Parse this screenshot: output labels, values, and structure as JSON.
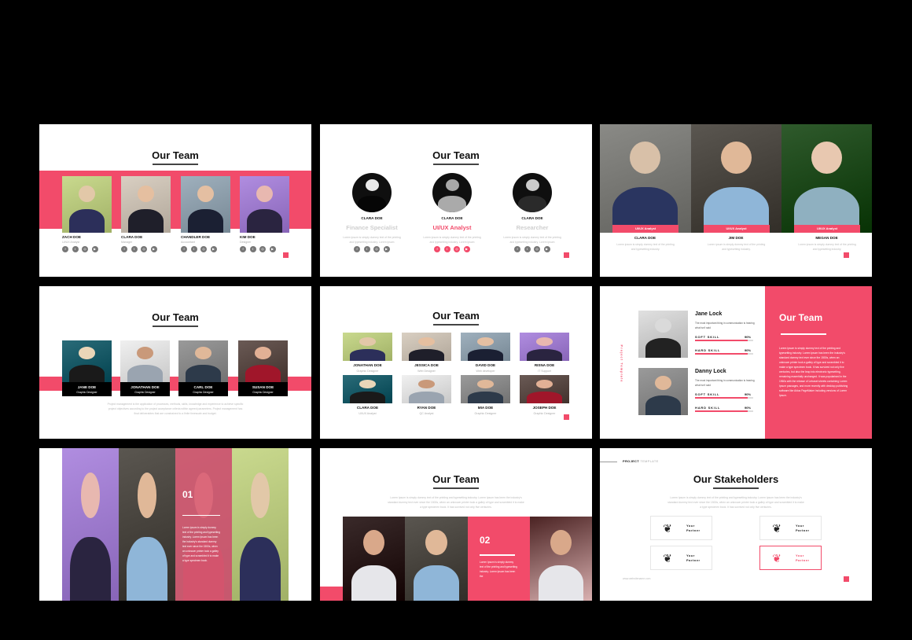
{
  "colors": {
    "accent": "#f24b6a",
    "background": "#000000",
    "dark": "#111111",
    "muted": "#aaaaaa"
  },
  "lorem_short": "Lorem ipsum is simply dummy text of the printing and typesetting industry. Lorem ipsum",
  "social_icons": [
    "facebook-icon",
    "twitter-icon",
    "instagram-icon",
    "youtube-icon"
  ],
  "slides": [
    {
      "title": "Our Team",
      "members": [
        {
          "name": "ZACH DOE",
          "role": "UI/UX Analyst"
        },
        {
          "name": "CLARA DOE",
          "role": "Manager"
        },
        {
          "name": "CHANDLER DOE",
          "role": "Accountant"
        },
        {
          "name": "KIM DOE",
          "role": "Designer"
        }
      ]
    },
    {
      "title": "Our Team",
      "members": [
        {
          "name": "CLARA DOE",
          "role": "Finance Specialist",
          "text": "Lorem ipsum is simply dummy text of the printing and typesetting industry. Lorem ipsum"
        },
        {
          "name": "CLARA DOE",
          "role": "UI/UX Analyst",
          "text": "Lorem ipsum is simply dummy text of the printing and typesetting industry. Lorem ipsum"
        },
        {
          "name": "CLARA DOE",
          "role": "Researcher",
          "text": "Lorem ipsum is simply dummy text of the printing and typesetting industry. Lorem ipsum"
        }
      ]
    },
    {
      "members": [
        {
          "name": "CLARA DOE",
          "role": "UI/UX Analyst",
          "text": "Lorem ipsum is simply dummy text of the printing and typesetting industry."
        },
        {
          "name": "JIM DOE",
          "role": "UI/UX Analyst",
          "text": "Lorem ipsum is simply dummy text of the printing and typesetting industry."
        },
        {
          "name": "MEGAN DOE",
          "role": "UI/UX Analyst",
          "text": "Lorem ipsum is simply dummy text of the printing and typesetting industry."
        }
      ]
    },
    {
      "title": "Our Team",
      "members": [
        {
          "name": "JANE DOE",
          "role": "Graphic Designer"
        },
        {
          "name": "JONATHAN DOE",
          "role": "Graphic Designer"
        },
        {
          "name": "CARL DOE",
          "role": "Graphic Designer"
        },
        {
          "name": "SUSAN DOE",
          "role": "Graphic Designer"
        }
      ],
      "text": "Project management is the application of processes, methods, skills, knowledge and experience to achieve specific project objectives according to the project acceptance criteria within agreed parameters. Project management has final deliverables that are constrained to a finite timescale and budget."
    },
    {
      "title": "Our Team",
      "members": [
        {
          "name": "JONATHAN DOE",
          "role": "Graphic Designer"
        },
        {
          "name": "JESSICA DOE",
          "role": "Web Designer"
        },
        {
          "name": "DAVID DOE",
          "role": "Web developer"
        },
        {
          "name": "RISNA DOE",
          "role": "IT Support"
        },
        {
          "name": "CLARA DOE",
          "role": "UI/UX Analyst"
        },
        {
          "name": "RYAN DOE",
          "role": "QC Analyst"
        },
        {
          "name": "MIA DOE",
          "role": "Graphic Designer"
        },
        {
          "name": "JOSEPH DOE",
          "role": "Graphic Designer"
        }
      ]
    },
    {
      "title": "Our Team",
      "side_label": "Project Template",
      "text": "Lorem Ipsum is simply dummy text of the printing and typesetting industry. Lorem Ipsum has been the industry's standard dummy text ever since the 1500s, when an unknown printer took a galley of type and scrambled it to make a type specimen book. It has survived not only five centuries, but also the leap into electronic typesetting, remaining essentially unchanged. It was popularised in the 1960s with the release of Letraset sheets containing Lorem Ipsum passages, and more recently with desktop publishing software like Aldus PageMaker including versions of Lorem Ipsum.",
      "people": [
        {
          "name": "Jane Lock",
          "desc": "The most important thing in communication is hearing what isn't said",
          "skills": [
            {
              "label": "SOFT SKILL",
              "value": "90%",
              "pct": 90
            },
            {
              "label": "HARD SKILL",
              "value": "90%",
              "pct": 90
            }
          ]
        },
        {
          "name": "Danny Lock",
          "desc": "The most important thing in communication is hearing what isn't said",
          "skills": [
            {
              "label": "SOFT SKILL",
              "value": "90%",
              "pct": 90
            },
            {
              "label": "HARD SKILL",
              "value": "90%",
              "pct": 90
            }
          ]
        }
      ]
    },
    {
      "number": "01",
      "text": "Lorem ipsum is simply dummy text of the printing and typesetting industry. Lorem Ipsum has been the industry's standard dummy text ever since the 1500s, when an unknown printer took a galley of type and scrambled it to make a type specimen book."
    },
    {
      "title": "Our Team",
      "intro": "Lorem Ipsum is simply dummy text of the printing and typesetting industry. Lorem Ipsum has been the industry's standard dummy text ever since the 1500s, when an unknown printer took a galley of type and scrambled it to make a type specimen book. It has survived not only five centuries.",
      "number": "02",
      "text": "Lorem Ipsum is simply dummy text of the printing and typesetting industry. Lorem Ipsum has been the"
    },
    {
      "header_bold": "PROJECT",
      "header_light": "TEMPLATE",
      "title": "Our Stakeholders",
      "intro": "Lorem Ipsum is simply dummy text of the printing and typesetting industry. Lorem Ipsum has been the industry's standard dummy text ever since the 1500s, when an unknown printer took a galley of type and scrambled it to make a type specimen book. It has survived not only five centuries.",
      "partners": [
        {
          "line1": "Your",
          "line2": "Partner",
          "highlight": false
        },
        {
          "line1": "Your",
          "line2": "Partner",
          "highlight": false
        },
        {
          "line1": "Your",
          "line2": "Partner",
          "highlight": false
        },
        {
          "line1": "Your",
          "line2": "Partner",
          "highlight": true
        }
      ],
      "website": "www.websitename.com"
    }
  ]
}
